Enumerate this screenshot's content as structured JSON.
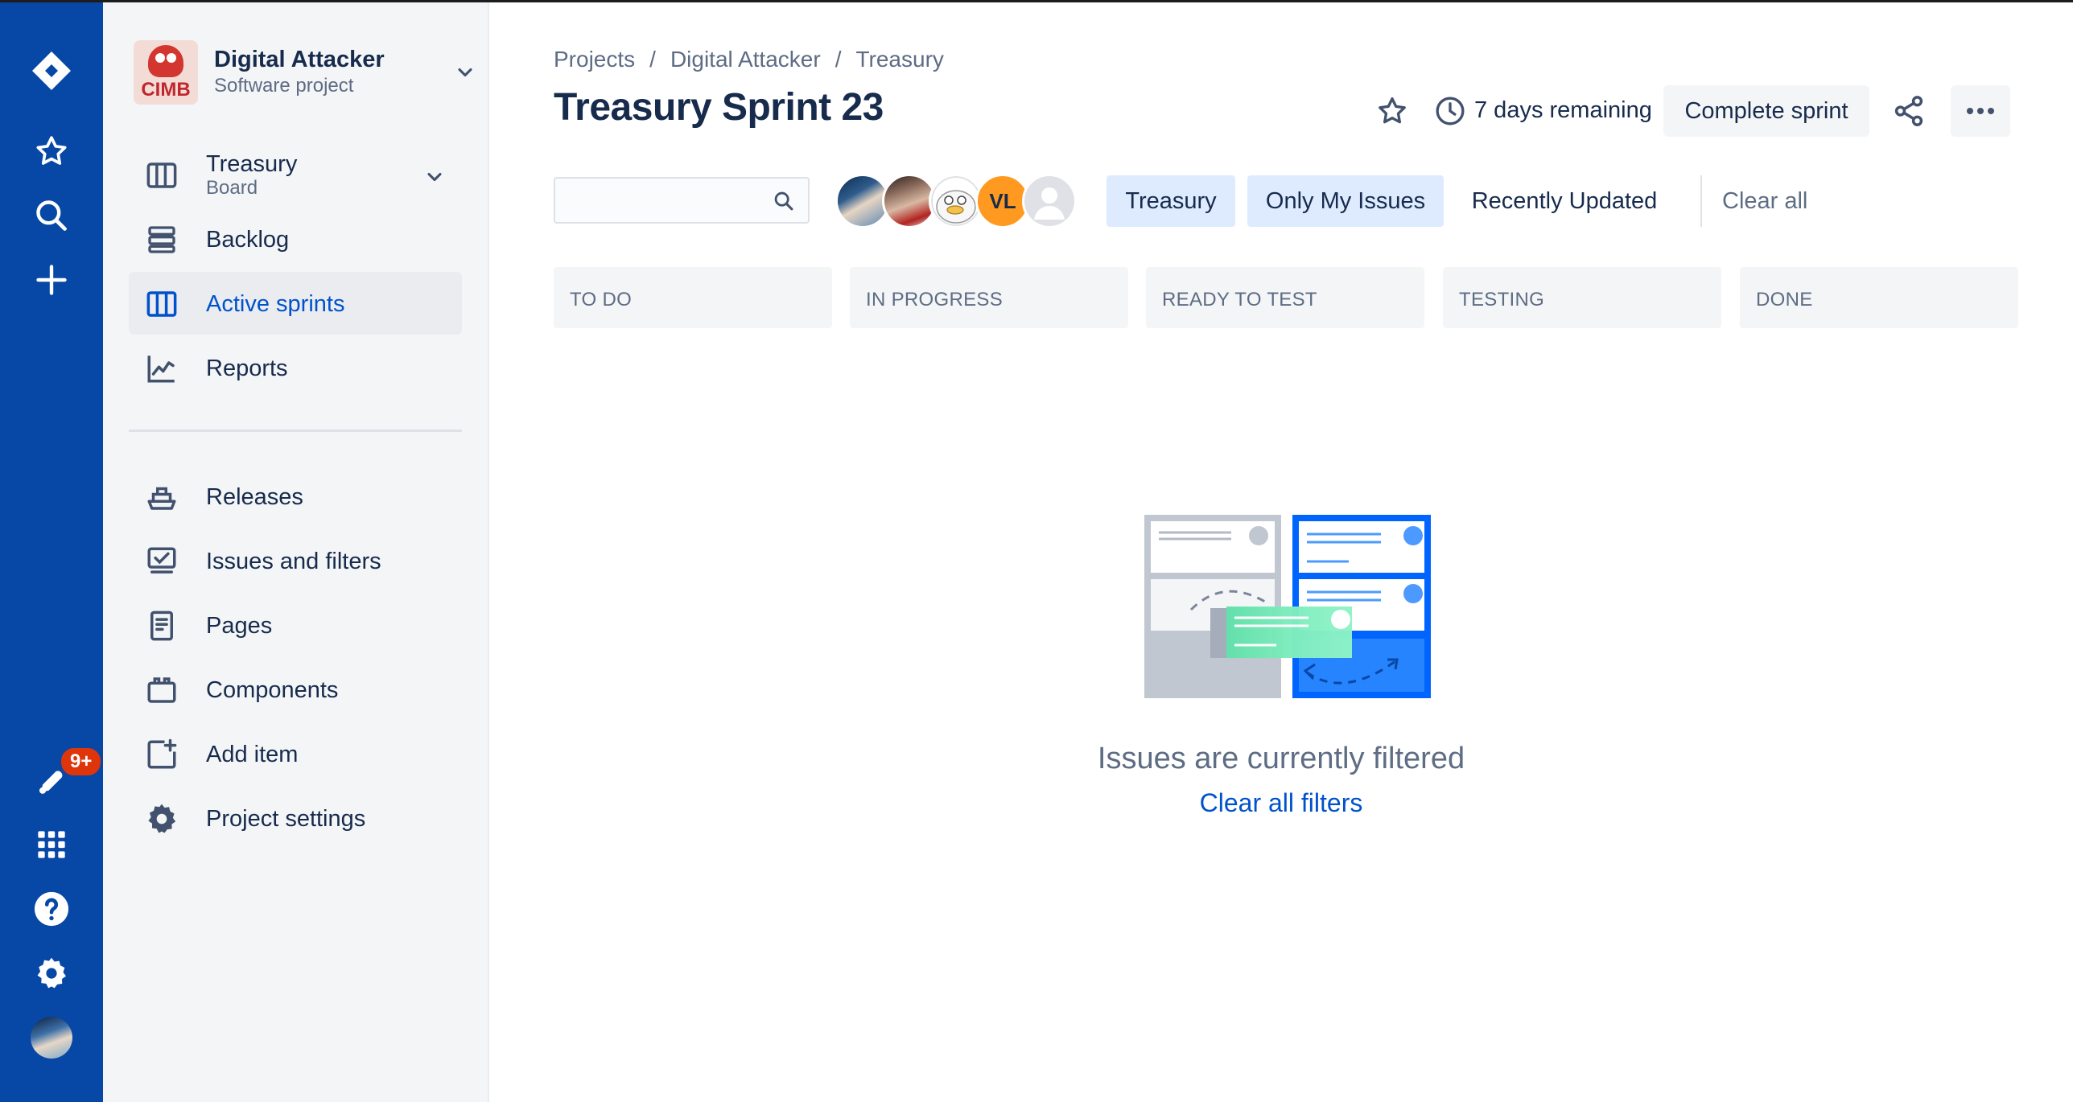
{
  "sidebar": {
    "project_name": "Digital Attacker",
    "project_type": "Software project",
    "project_logo_text": "CIMB",
    "board_name": "Treasury",
    "board_sub": "Board",
    "items": [
      {
        "label": "Backlog",
        "icon": "backlog-icon"
      },
      {
        "label": "Active sprints",
        "icon": "board-columns-icon",
        "active": true
      },
      {
        "label": "Reports",
        "icon": "chart-line-icon"
      },
      {
        "label": "Releases",
        "icon": "ship-icon"
      },
      {
        "label": "Issues and filters",
        "icon": "issues-filter-icon"
      },
      {
        "label": "Pages",
        "icon": "page-icon"
      },
      {
        "label": "Components",
        "icon": "components-icon"
      },
      {
        "label": "Add item",
        "icon": "add-item-icon"
      },
      {
        "label": "Project settings",
        "icon": "gear-icon"
      }
    ]
  },
  "global_nav": {
    "notifications_badge": "9+"
  },
  "breadcrumbs": [
    "Projects",
    "Digital Attacker",
    "Treasury"
  ],
  "page": {
    "title": "Treasury Sprint 23",
    "remaining": "7 days remaining",
    "complete_label": "Complete sprint"
  },
  "filters": {
    "search_value": "",
    "avatar_initials": "VL",
    "chips": [
      "Treasury",
      "Only My Issues",
      "Recently Updated"
    ],
    "clear_all": "Clear all"
  },
  "columns": [
    "TO DO",
    "IN PROGRESS",
    "READY TO TEST",
    "TESTING",
    "DONE"
  ],
  "empty_state": {
    "title": "Issues are currently filtered",
    "link": "Clear all filters"
  },
  "colors": {
    "nav_bg": "#0747a6",
    "accent": "#0052cc",
    "selected_chip": "#deebff",
    "badge": "#de350b",
    "avatar_vl": "#ff991f"
  }
}
